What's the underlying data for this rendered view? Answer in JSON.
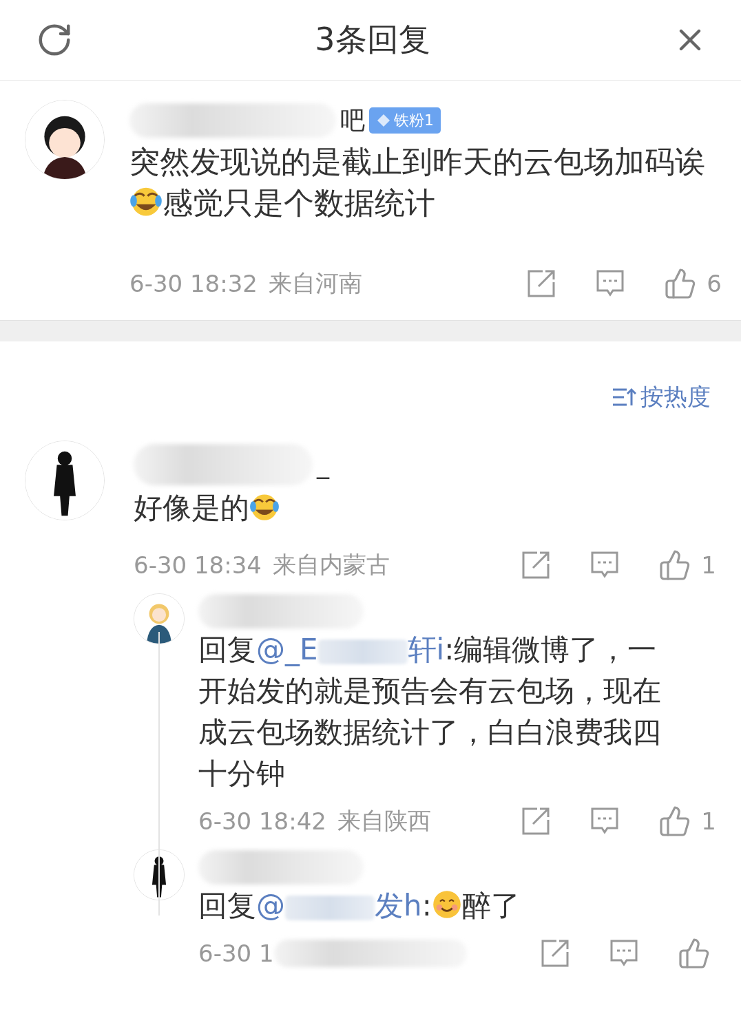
{
  "header": {
    "title": "3条回复"
  },
  "comment": {
    "name_redacted": true,
    "name": "吧",
    "badge": "铁粉1",
    "segments": [
      {
        "kind": "text",
        "text": "突然发现说的是截止到昨天的云包场加码诶"
      },
      {
        "kind": "laughing-emoji"
      },
      {
        "kind": "text",
        "text": "感觉只是个数据统计"
      }
    ],
    "time": "6-30 18:32",
    "location": "来自河南",
    "likes": "6"
  },
  "sort": {
    "label": "按热度"
  },
  "replies": [
    {
      "name_redacted": true,
      "name": "_",
      "segments": [
        {
          "kind": "text",
          "text": "好像是的"
        },
        {
          "kind": "laughing-emoji"
        }
      ],
      "time": "6-30 18:34",
      "location": "来自内蒙古",
      "likes": "1",
      "children": [
        {
          "name_redacted": true,
          "segments": [
            {
              "kind": "text",
              "text": "回复"
            },
            {
              "kind": "mention",
              "text": "@_E"
            },
            {
              "kind": "redacted"
            },
            {
              "kind": "mention",
              "text": "轩i"
            },
            {
              "kind": "text",
              "text": ":编辑微博了，一开始发的就是预告会有云包场，现在成云包场数据统计了，白白浪费我四十分钟"
            }
          ],
          "time": "6-30 18:42",
          "location": "来自陕西",
          "likes": "1"
        },
        {
          "name_redacted": true,
          "segments": [
            {
              "kind": "text",
              "text": "回复"
            },
            {
              "kind": "mention",
              "text": "@"
            },
            {
              "kind": "redacted"
            },
            {
              "kind": "mention",
              "text": "发h"
            },
            {
              "kind": "text",
              "text": ":"
            },
            {
              "kind": "smiling-emoji"
            },
            {
              "kind": "text",
              "text": "醉了"
            }
          ],
          "time": "6-30 1",
          "time_redacted": true
        }
      ]
    }
  ]
}
